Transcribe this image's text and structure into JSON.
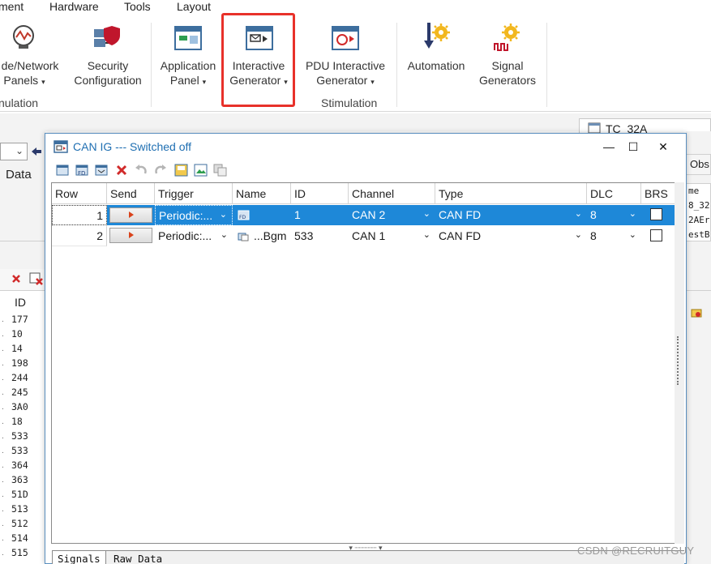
{
  "menu": {
    "items": [
      "ment",
      "Hardware",
      "Tools",
      "Layout"
    ]
  },
  "ribbon": {
    "buttons": [
      {
        "line1": "de/Network",
        "line2": "Panels",
        "dropdown": true,
        "icon": "network-panel-icon"
      },
      {
        "line1": "Security",
        "line2": "Configuration",
        "dropdown": false,
        "icon": "security-config-icon"
      },
      {
        "line1": "Application",
        "line2": "Panel",
        "dropdown": true,
        "icon": "application-panel-icon"
      },
      {
        "line1": "Interactive",
        "line2": "Generator",
        "dropdown": true,
        "icon": "interactive-generator-icon"
      },
      {
        "line1": "PDU Interactive",
        "line2": "Generator",
        "dropdown": true,
        "icon": "pdu-interactive-generator-icon"
      },
      {
        "line1": "Automation",
        "line2": "",
        "dropdown": false,
        "icon": "automation-icon"
      },
      {
        "line1": "Signal",
        "line2": "Generators",
        "dropdown": false,
        "icon": "signal-generators-icon"
      }
    ],
    "groups": [
      "nulation",
      "Stimulation"
    ],
    "dropdown_glyph": "▾"
  },
  "workspace": {
    "left_label": "Data",
    "left_list_header": "ID",
    "left_list_ids": [
      "177",
      "10",
      "14",
      "198",
      "244",
      "245",
      "3A0",
      "18",
      "533",
      "533",
      "364",
      "363",
      "51D",
      "513",
      "512",
      "514",
      "515"
    ],
    "tc_tab": "TC_32A",
    "right_obs": "Obs",
    "right_list": [
      "me",
      "8_32",
      "2AEr",
      "estB"
    ]
  },
  "dialog": {
    "title": "CAN IG --- Switched off",
    "window_controls": {
      "minimize": "—",
      "maximize": "☐",
      "close": "✕"
    },
    "toolbar_icons": [
      "add-frame-icon",
      "add-fd-frame-icon",
      "add-message-icon",
      "delete-icon",
      "undo-icon",
      "redo-icon",
      "save-config-icon",
      "load-config-icon",
      "copy-icon"
    ],
    "columns": [
      "Row",
      "Send",
      "Trigger",
      "Name",
      "ID",
      "Channel",
      "Type",
      "DLC",
      "BRS"
    ],
    "rows": [
      {
        "row": "1",
        "trigger": "Periodic:...",
        "name": "",
        "id": "1",
        "channel": "CAN 2",
        "type": "CAN FD",
        "dlc": "8",
        "selected": true
      },
      {
        "row": "2",
        "trigger": "Periodic:...",
        "name": "...Bgm",
        "id": "533",
        "channel": "CAN 1",
        "type": "CAN FD",
        "dlc": "8",
        "selected": false
      }
    ],
    "tabs": [
      "Signals",
      "Raw Data"
    ],
    "active_tab": "Signals"
  },
  "watermark": "CSDN @RECRUITGUY",
  "colors": {
    "selection": "#1e88d8",
    "title_text": "#1f6fb2",
    "highlight_box": "#e8312a"
  }
}
